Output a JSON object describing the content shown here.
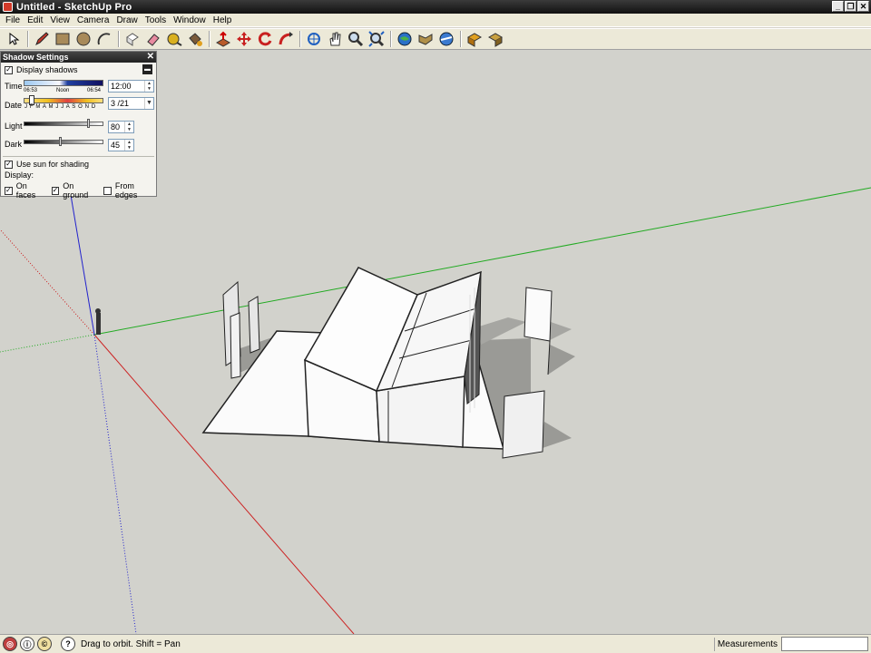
{
  "window": {
    "title": "Untitled - SketchUp Pro",
    "controls": [
      "_",
      "❐",
      "✕"
    ]
  },
  "menu": [
    "File",
    "Edit",
    "View",
    "Camera",
    "Draw",
    "Tools",
    "Window",
    "Help"
  ],
  "toolbar": {
    "tools": [
      "select-icon",
      "pencil-icon",
      "rectangle-icon",
      "circle-icon",
      "arc-icon",
      "make-component-icon",
      "eraser-icon",
      "tape-measure-icon",
      "paint-bucket-icon",
      "push-pull-icon",
      "move-icon",
      "rotate-icon",
      "follow-me-icon",
      "orbit-icon",
      "pan-icon",
      "zoom-icon",
      "zoom-extents-icon",
      "get-models-icon",
      "share-model-icon",
      "google-earth-icon",
      "get-current-view-icon",
      "toggle-terrain-icon"
    ]
  },
  "shadow_panel": {
    "title": "Shadow Settings",
    "display_shadows_label": "Display shadows",
    "display_shadows_checked": true,
    "time_label": "Time",
    "time_start": "06:53",
    "time_noon": "Noon",
    "time_end": "06:54",
    "time_value": "12:00",
    "date_label": "Date",
    "months": "J F M A M J J A S O N D",
    "date_value": "3 /21",
    "light_label": "Light",
    "light_value": "80",
    "light_level": 0.8,
    "dark_label": "Dark",
    "dark_value": "45",
    "dark_level": 0.45,
    "use_sun_label": "Use sun for shading",
    "use_sun_checked": true,
    "display_label": "Display:",
    "on_faces_label": "On faces",
    "on_faces_checked": true,
    "on_ground_label": "On ground",
    "on_ground_checked": true,
    "from_edges_label": "From edges",
    "from_edges_checked": false
  },
  "status": {
    "hint": "Drag to orbit.  Shift = Pan",
    "measurements_label": "Measurements",
    "measurements_value": ""
  },
  "colors": {
    "red_axis": "#cc2222",
    "green_axis": "#22aa22",
    "blue_axis": "#2222cc",
    "background": "#d2d2cc"
  }
}
